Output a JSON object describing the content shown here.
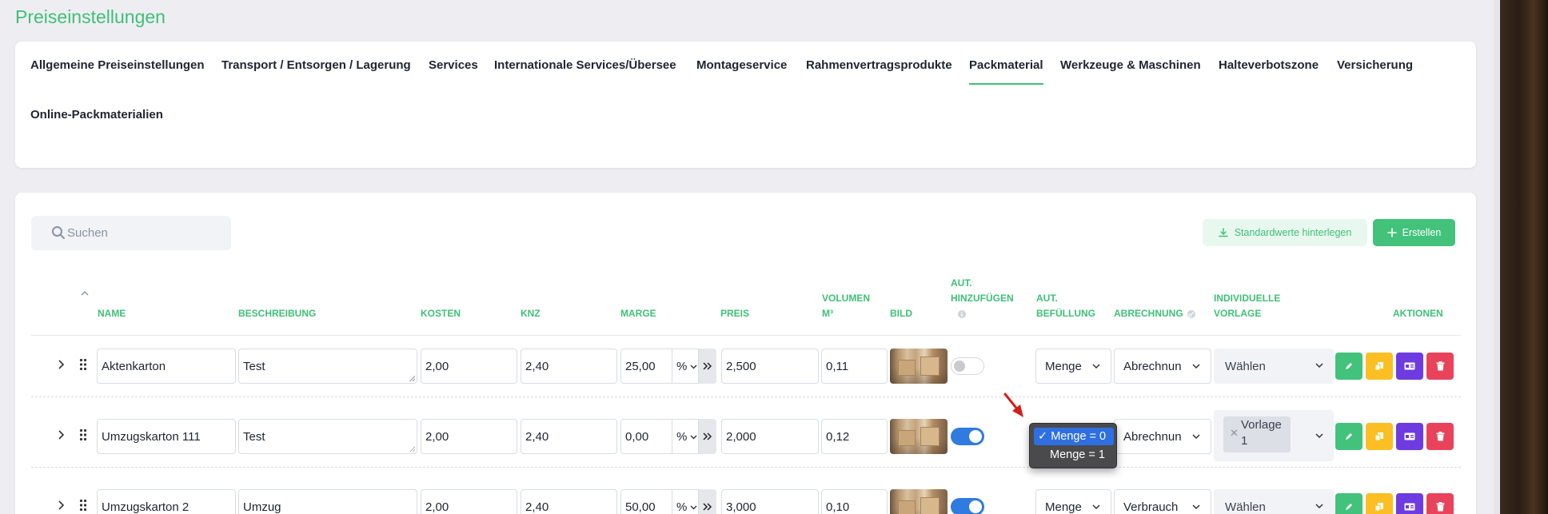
{
  "page": {
    "title": "Preiseinstellungen"
  },
  "tabs": [
    {
      "label": "Allgemeine Preiseinstellungen",
      "active": false
    },
    {
      "label": "Transport / Entsorgen / Lagerung",
      "active": false
    },
    {
      "label": "Services",
      "active": false
    },
    {
      "label": "Internationale Services/Übersee",
      "active": false
    },
    {
      "label": "Montageservice",
      "active": false
    },
    {
      "label": "Rahmenvertragsprodukte",
      "active": false
    },
    {
      "label": "Packmaterial",
      "active": true
    },
    {
      "label": "Werkzeuge & Maschinen",
      "active": false
    },
    {
      "label": "Halteverbotszone",
      "active": false
    },
    {
      "label": "Versicherung",
      "active": false
    },
    {
      "label": "Online-Packmaterialien",
      "active": false
    }
  ],
  "toolbar": {
    "search_placeholder": "Suchen",
    "standard_label": "Standardwerte hinterlegen",
    "create_label": "Erstellen"
  },
  "columns": {
    "name": "NAME",
    "beschreibung": "BESCHREIBUNG",
    "kosten": "KOSTEN",
    "knz": "KNZ",
    "marge": "MARGE",
    "preis": "PREIS",
    "volumen_1": "VOLUMEN",
    "volumen_2": "M³",
    "bild": "BILD",
    "aut_hinzu_1": "AUT.",
    "aut_hinzu_2": "HINZUFÜGEN",
    "aut_bef_1": "AUT.",
    "aut_bef_2": "BEFÜLLUNG",
    "abrechnung": "ABRECHNUNG",
    "vorlage_1": "INDIVIDUELLE",
    "vorlage_2": "VORLAGE",
    "aktionen": "AKTIONEN"
  },
  "rows": [
    {
      "name": "Aktenkarton",
      "beschreibung": "Test",
      "kosten": "2,00",
      "knz": "2,40",
      "marge": "25,00",
      "marge_unit": "%",
      "preis": "2,500",
      "volumen": "0,11",
      "aut_hinzufuegen": false,
      "aut_befuellung": "Menge",
      "abrechnung": "Abrechnun",
      "vorlage": "Wählen"
    },
    {
      "name": "Umzugskarton 111",
      "beschreibung": "Test",
      "kosten": "2,00",
      "knz": "2,40",
      "marge": "0,00",
      "marge_unit": "%",
      "preis": "2,000",
      "volumen": "0,12",
      "aut_hinzufuegen": true,
      "aut_befuellung": "",
      "abrechnung": "Abrechnun",
      "vorlage_tag_1": "Vorlage",
      "vorlage_tag_2": "1"
    },
    {
      "name": "Umzugskarton 2",
      "beschreibung": "Umzug",
      "kosten": "2,00",
      "knz": "2,40",
      "marge": "50,00",
      "marge_unit": "%",
      "preis": "3,000",
      "volumen": "0,10",
      "aut_hinzufuegen": true,
      "aut_befuellung": "Menge",
      "abrechnung": "Verbrauch",
      "vorlage": "Wählen"
    }
  ],
  "dropdown": {
    "options": [
      "Menge = 0",
      "Menge = 1"
    ],
    "selected": "Menge = 0"
  },
  "colors": {
    "accent": "#3fbf78",
    "toggle_on": "#2f7be0",
    "edit": "#42c27b",
    "copy": "#fbbf24",
    "card": "#6d3be0",
    "delete": "#e8435a",
    "dropdown_selected": "#2f6fe0"
  }
}
